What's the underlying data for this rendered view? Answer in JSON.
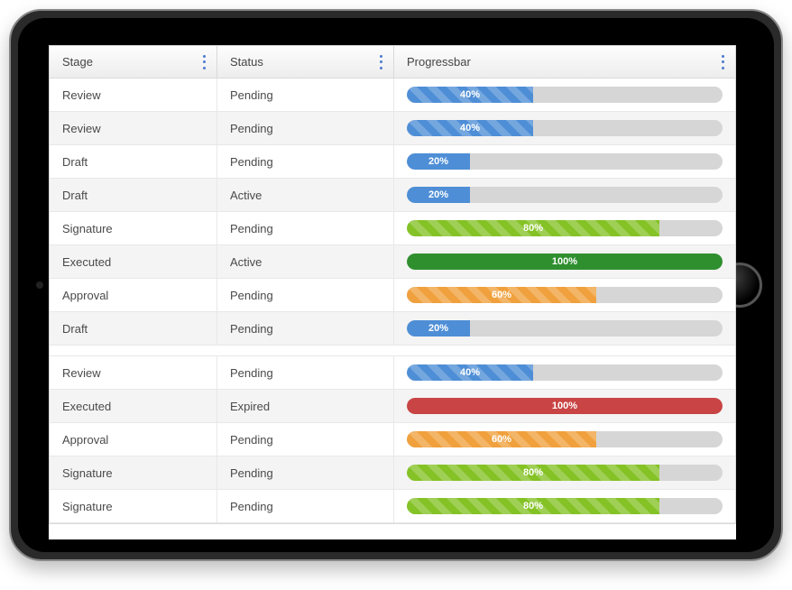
{
  "columns": {
    "stage": "Stage",
    "status": "Status",
    "progress": "Progressbar"
  },
  "rows": [
    {
      "stage": "Review",
      "status": "Pending",
      "pct": 40,
      "label": "40%",
      "color": "blue",
      "striped": true
    },
    {
      "stage": "Review",
      "status": "Pending",
      "pct": 40,
      "label": "40%",
      "color": "blue",
      "striped": true
    },
    {
      "stage": "Draft",
      "status": "Pending",
      "pct": 20,
      "label": "20%",
      "color": "blue",
      "striped": false
    },
    {
      "stage": "Draft",
      "status": "Active",
      "pct": 20,
      "label": "20%",
      "color": "blue",
      "striped": false
    },
    {
      "stage": "Signature",
      "status": "Pending",
      "pct": 80,
      "label": "80%",
      "color": "green",
      "striped": true
    },
    {
      "stage": "Executed",
      "status": "Active",
      "pct": 100,
      "label": "100%",
      "color": "dgreen",
      "striped": false
    },
    {
      "stage": "Approval",
      "status": "Pending",
      "pct": 60,
      "label": "60%",
      "color": "orange",
      "striped": true
    },
    {
      "stage": "Draft",
      "status": "Pending",
      "pct": 20,
      "label": "20%",
      "color": "blue",
      "striped": false
    },
    {
      "gap": true
    },
    {
      "stage": "Review",
      "status": "Pending",
      "pct": 40,
      "label": "40%",
      "color": "blue",
      "striped": true
    },
    {
      "stage": "Executed",
      "status": "Expired",
      "pct": 100,
      "label": "100%",
      "color": "red",
      "striped": false
    },
    {
      "stage": "Approval",
      "status": "Pending",
      "pct": 60,
      "label": "60%",
      "color": "orange",
      "striped": true
    },
    {
      "stage": "Signature",
      "status": "Pending",
      "pct": 80,
      "label": "80%",
      "color": "green",
      "striped": true
    },
    {
      "stage": "Signature",
      "status": "Pending",
      "pct": 80,
      "label": "80%",
      "color": "green",
      "striped": true
    }
  ]
}
